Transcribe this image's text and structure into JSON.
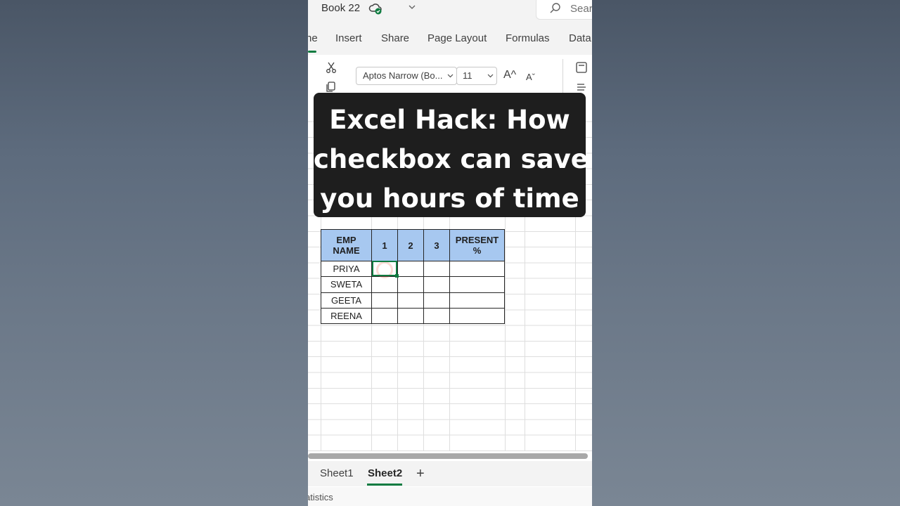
{
  "titlebar": {
    "book_title": "Book 22",
    "search_placeholder": "Search"
  },
  "tabs": [
    "ne",
    "Insert",
    "Share",
    "Page Layout",
    "Formulas",
    "Data"
  ],
  "ribbon": {
    "font_name": "Aptos Narrow (Bo...",
    "font_size": "11",
    "grow_font": "A^",
    "shrink_font": "Aˇ"
  },
  "caption": {
    "line1": "Excel Hack: How",
    "line2": "checkbox can save",
    "line3": "you hours of time"
  },
  "table": {
    "headers": {
      "name_line1": "EMP",
      "name_line2": "NAME",
      "d1": "1",
      "d2": "2",
      "d3": "3",
      "present_line1": "PRESENT",
      "present_line2": "%"
    },
    "rows": [
      "PRIYA",
      "SWETA",
      "GEETA",
      "REENA"
    ]
  },
  "sheets": {
    "sheet1": "Sheet1",
    "sheet2": "Sheet2",
    "add": "+"
  },
  "status": {
    "text": "atistics"
  },
  "colors": {
    "accent_green": "#107c41",
    "header_blue": "#a7c8f0",
    "caption_bg": "#1e1e1e"
  }
}
